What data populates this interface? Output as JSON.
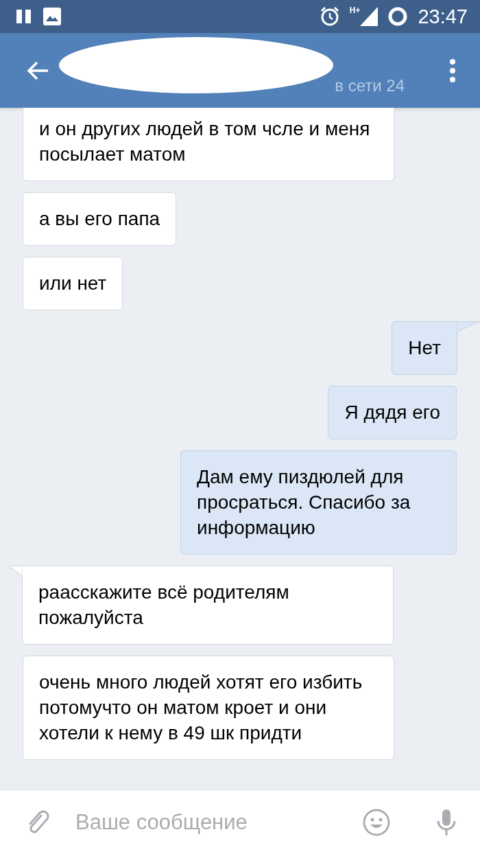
{
  "status_bar": {
    "network": "H+",
    "time": "23:47"
  },
  "header": {
    "status": "в сети 24"
  },
  "messages": [
    {
      "outgoing": false,
      "tail": false,
      "cut_top": true,
      "text": "и он других людей в том чсле и меня посылает матом"
    },
    {
      "outgoing": false,
      "tail": false,
      "cut_top": false,
      "text": "а вы его папа"
    },
    {
      "outgoing": false,
      "tail": false,
      "cut_top": false,
      "text": "или нет"
    },
    {
      "outgoing": true,
      "tail": true,
      "cut_top": false,
      "text": "Нет"
    },
    {
      "outgoing": true,
      "tail": false,
      "cut_top": false,
      "text": "Я дядя его"
    },
    {
      "outgoing": true,
      "tail": false,
      "cut_top": false,
      "text": "Дам ему пиздюлей для просраться. Спасибо за информацию"
    },
    {
      "outgoing": false,
      "tail": true,
      "cut_top": false,
      "text": "раасскажите всё родителям пожалуйста"
    },
    {
      "outgoing": false,
      "tail": false,
      "cut_top": false,
      "text": "очень много людей хотят его избить потомучто он матом кроет и они хотели к нему в 49 шк придти"
    }
  ],
  "composer": {
    "placeholder": "Ваше сообщение"
  }
}
